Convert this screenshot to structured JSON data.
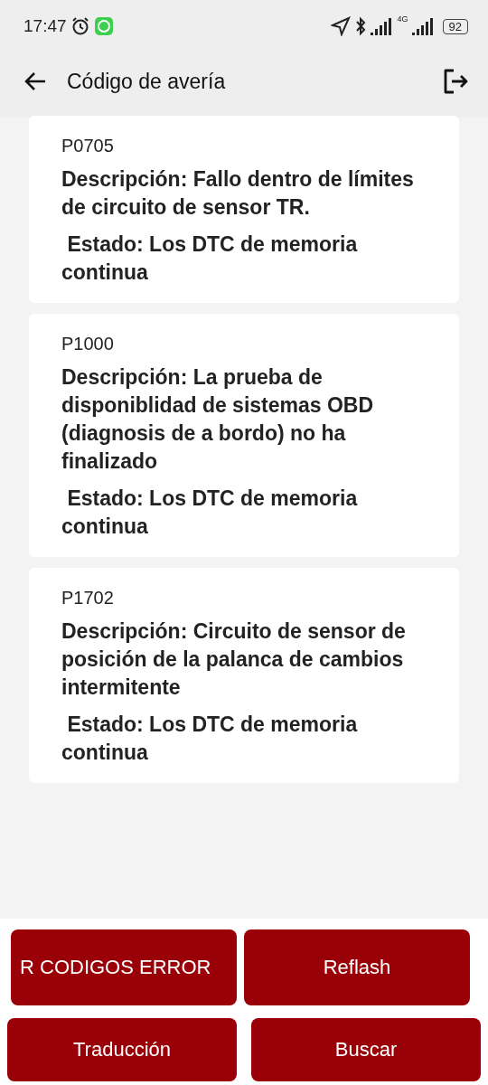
{
  "status_bar": {
    "time": "17:47",
    "battery": "92",
    "network": "4G"
  },
  "header": {
    "title": "Código de avería"
  },
  "faults": [
    {
      "code": "P0705",
      "description": "Descripción: Fallo dentro de límites de circuito de sensor TR.",
      "status": " Estado: Los DTC de memoria continua"
    },
    {
      "code": "P1000",
      "description": "Descripción: La prueba de disponiblidad de sistemas OBD (diagnosis de a bordo) no ha finalizado",
      "status": " Estado: Los DTC de memoria continua"
    },
    {
      "code": "P1702",
      "description": "Descripción: Circuito de sensor de posición de la palanca de cambios intermitente",
      "status": " Estado: Los DTC de memoria continua"
    }
  ],
  "buttons": [
    [
      "R CODIGOS ERROR",
      "Reflash"
    ],
    [
      "Traducción",
      "Buscar"
    ]
  ]
}
